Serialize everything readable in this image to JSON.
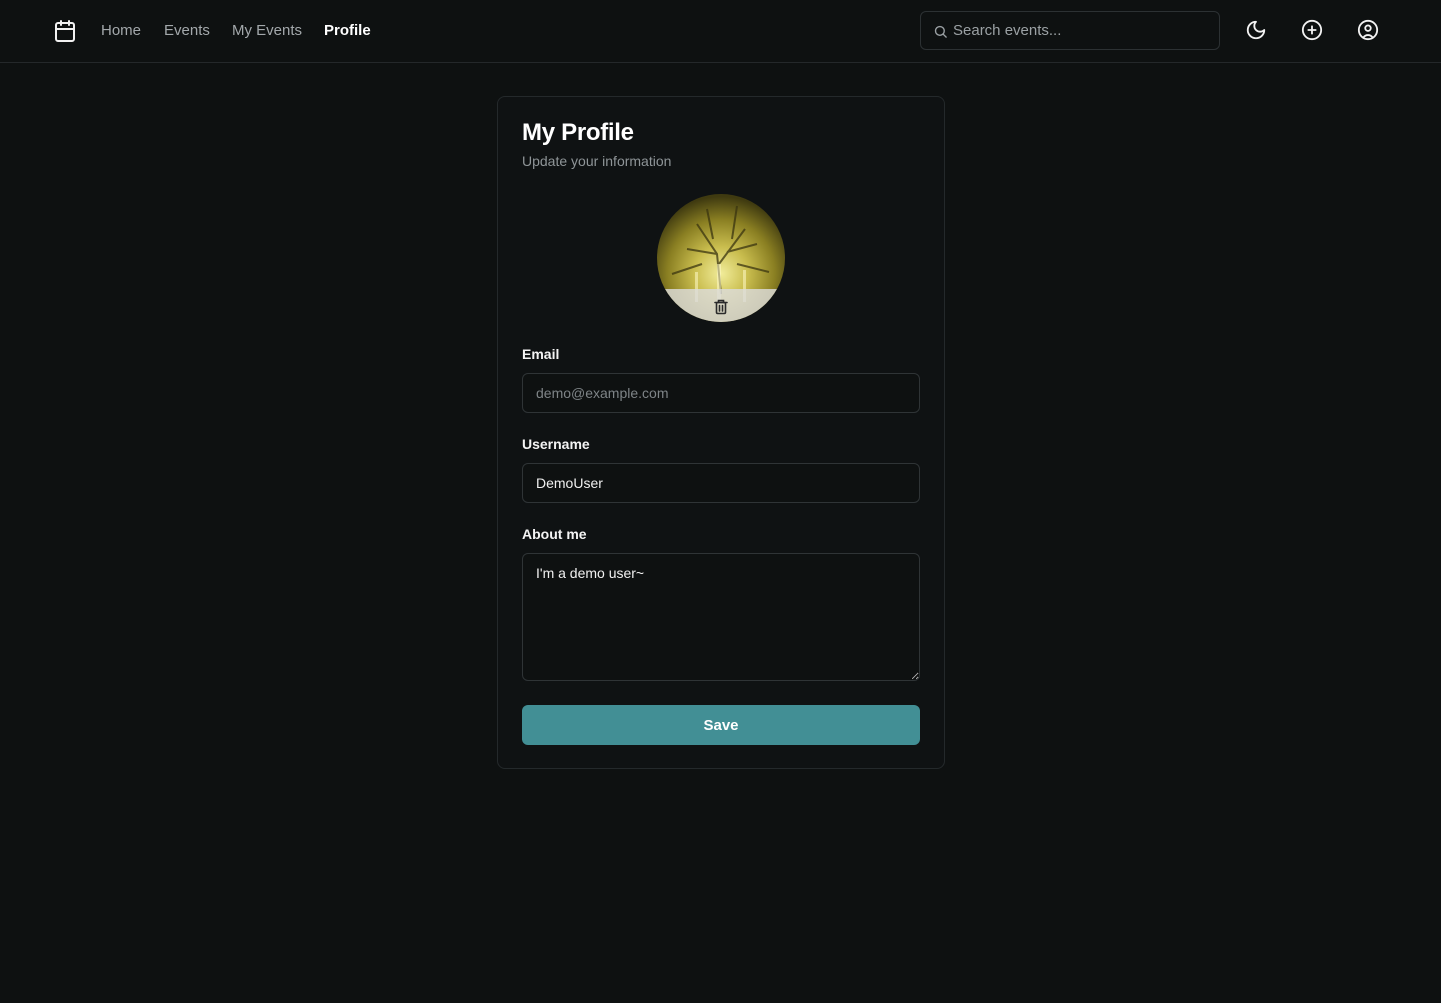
{
  "nav": {
    "links": [
      {
        "label": "Home"
      },
      {
        "label": "Events"
      },
      {
        "label": "My Events"
      },
      {
        "label": "Profile",
        "active": true
      }
    ],
    "search_placeholder": "Search events..."
  },
  "profile": {
    "title": "My Profile",
    "subtitle": "Update your information",
    "email_label": "Email",
    "email_placeholder": "demo@example.com",
    "email_value": "",
    "username_label": "Username",
    "username_value": "DemoUser",
    "about_label": "About me",
    "about_value": "I'm a demo user~",
    "save_label": "Save"
  },
  "icons": {
    "logo": "calendar-icon",
    "search": "search-icon",
    "theme": "moon-icon",
    "create": "plus-circle-icon",
    "account": "user-circle-icon",
    "avatar_action": "trash-icon"
  },
  "colors": {
    "background": "#0e1111",
    "accent": "#428f95"
  }
}
